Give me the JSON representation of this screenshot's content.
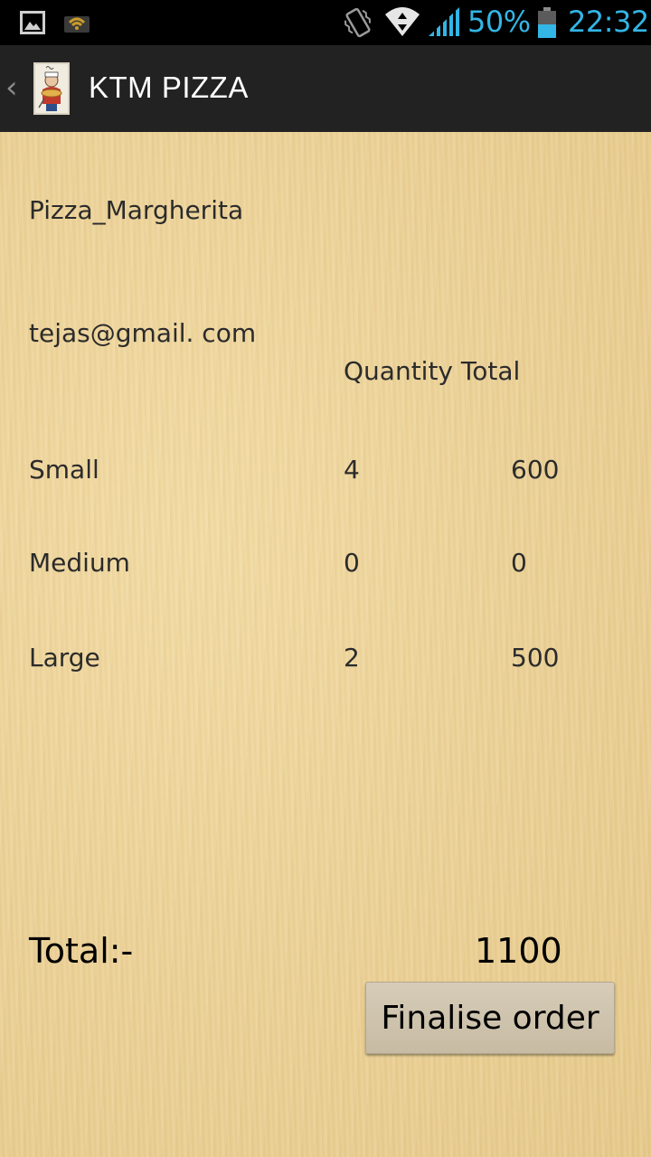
{
  "status_bar": {
    "battery_percent": "50%",
    "time": "22:32",
    "icons": [
      "image-notification-icon",
      "wifi-notification-icon",
      "vibrate-icon",
      "wifi-signal-icon",
      "cellular-signal-icon",
      "battery-icon"
    ],
    "accent_color": "#33b5e5"
  },
  "action_bar": {
    "title": "KTM PIZZA",
    "icons": [
      "up-caret-icon",
      "app-logo-icon"
    ]
  },
  "order": {
    "pizza_name": "Pizza_Margherita",
    "email": "tejas@gmail. com",
    "header_quantity_total": "Quantity Total",
    "rows": [
      {
        "size": "Small",
        "quantity": "4",
        "total": "600"
      },
      {
        "size": "Medium",
        "quantity": "0",
        "total": "0"
      },
      {
        "size": "Large",
        "quantity": "2",
        "total": "500"
      }
    ],
    "total_label": "Total:-",
    "total_value": "1100",
    "finalise_button_label": "Finalise order"
  }
}
